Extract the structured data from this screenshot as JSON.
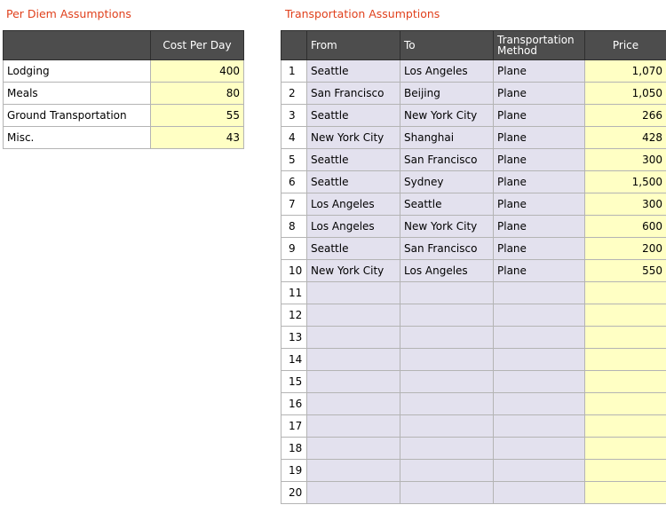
{
  "per_diem": {
    "title": "Per Diem Assumptions",
    "header_label": "",
    "header_cost": "Cost Per Day",
    "rows": [
      {
        "label": "Lodging",
        "cost": "400"
      },
      {
        "label": "Meals",
        "cost": "80"
      },
      {
        "label": "Ground Transportation",
        "cost": "55"
      },
      {
        "label": "Misc.",
        "cost": "43"
      }
    ]
  },
  "transportation": {
    "title": "Transportation Assumptions",
    "headers": {
      "index": "",
      "from": "From",
      "to": "To",
      "method_line1": "Transportation",
      "method_line2": "Method",
      "price": "Price"
    },
    "rows": [
      {
        "n": "1",
        "from": "Seattle",
        "to": "Los Angeles",
        "method": "Plane",
        "price": "1,070"
      },
      {
        "n": "2",
        "from": "San Francisco",
        "to": "Beijing",
        "method": "Plane",
        "price": "1,050"
      },
      {
        "n": "3",
        "from": "Seattle",
        "to": "New York City",
        "method": "Plane",
        "price": "266"
      },
      {
        "n": "4",
        "from": "New York City",
        "to": "Shanghai",
        "method": "Plane",
        "price": "428"
      },
      {
        "n": "5",
        "from": "Seattle",
        "to": "San Francisco",
        "method": "Plane",
        "price": "300"
      },
      {
        "n": "6",
        "from": "Seattle",
        "to": "Sydney",
        "method": "Plane",
        "price": "1,500"
      },
      {
        "n": "7",
        "from": "Los Angeles",
        "to": "Seattle",
        "method": "Plane",
        "price": "300"
      },
      {
        "n": "8",
        "from": "Los Angeles",
        "to": "New York City",
        "method": "Plane",
        "price": "600"
      },
      {
        "n": "9",
        "from": "Seattle",
        "to": "San Francisco",
        "method": "Plane",
        "price": "200"
      },
      {
        "n": "10",
        "from": "New York City",
        "to": "Los Angeles",
        "method": "Plane",
        "price": "550"
      },
      {
        "n": "11",
        "from": "",
        "to": "",
        "method": "",
        "price": ""
      },
      {
        "n": "12",
        "from": "",
        "to": "",
        "method": "",
        "price": ""
      },
      {
        "n": "13",
        "from": "",
        "to": "",
        "method": "",
        "price": ""
      },
      {
        "n": "14",
        "from": "",
        "to": "",
        "method": "",
        "price": ""
      },
      {
        "n": "15",
        "from": "",
        "to": "",
        "method": "",
        "price": ""
      },
      {
        "n": "16",
        "from": "",
        "to": "",
        "method": "",
        "price": ""
      },
      {
        "n": "17",
        "from": "",
        "to": "",
        "method": "",
        "price": ""
      },
      {
        "n": "18",
        "from": "",
        "to": "",
        "method": "",
        "price": ""
      },
      {
        "n": "19",
        "from": "",
        "to": "",
        "method": "",
        "price": ""
      },
      {
        "n": "20",
        "from": "",
        "to": "",
        "method": "",
        "price": ""
      }
    ]
  }
}
